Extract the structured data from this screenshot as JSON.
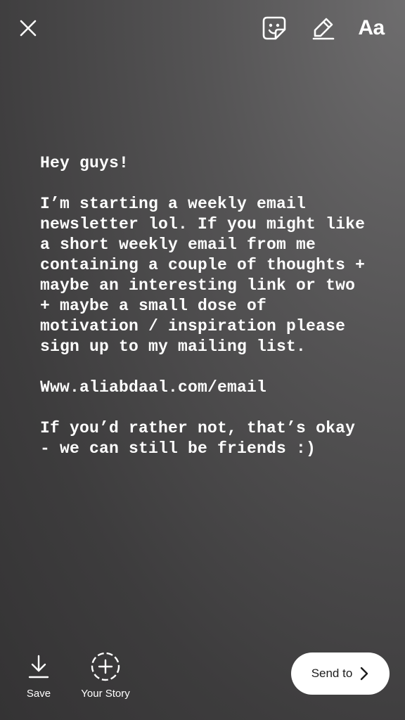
{
  "top_toolbar": {
    "close_icon": "close-icon",
    "sticker_icon": "sticker-icon",
    "draw_icon": "pen-icon",
    "text_tool_label": "Aa"
  },
  "story": {
    "text": "Hey guys!\n\nI’m starting a weekly email newsletter lol. If you might like a short weekly email from me containing a couple of thoughts + maybe an interesting link or two + maybe a small dose of motivation / inspiration please sign up to my mailing list.\n\nWww.aliabdaal.com/email\n\nIf you’d rather not, that’s okay - we can still be friends :)",
    "text_color": "#ffffff",
    "background_colors": [
      "#6e6d6e",
      "#343334"
    ]
  },
  "bottom_bar": {
    "save_label": "Save",
    "save_icon": "download-icon",
    "your_story_label": "Your Story",
    "your_story_icon": "add-story-icon",
    "send_to_label": "Send to",
    "send_to_icon": "chevron-right-icon"
  }
}
